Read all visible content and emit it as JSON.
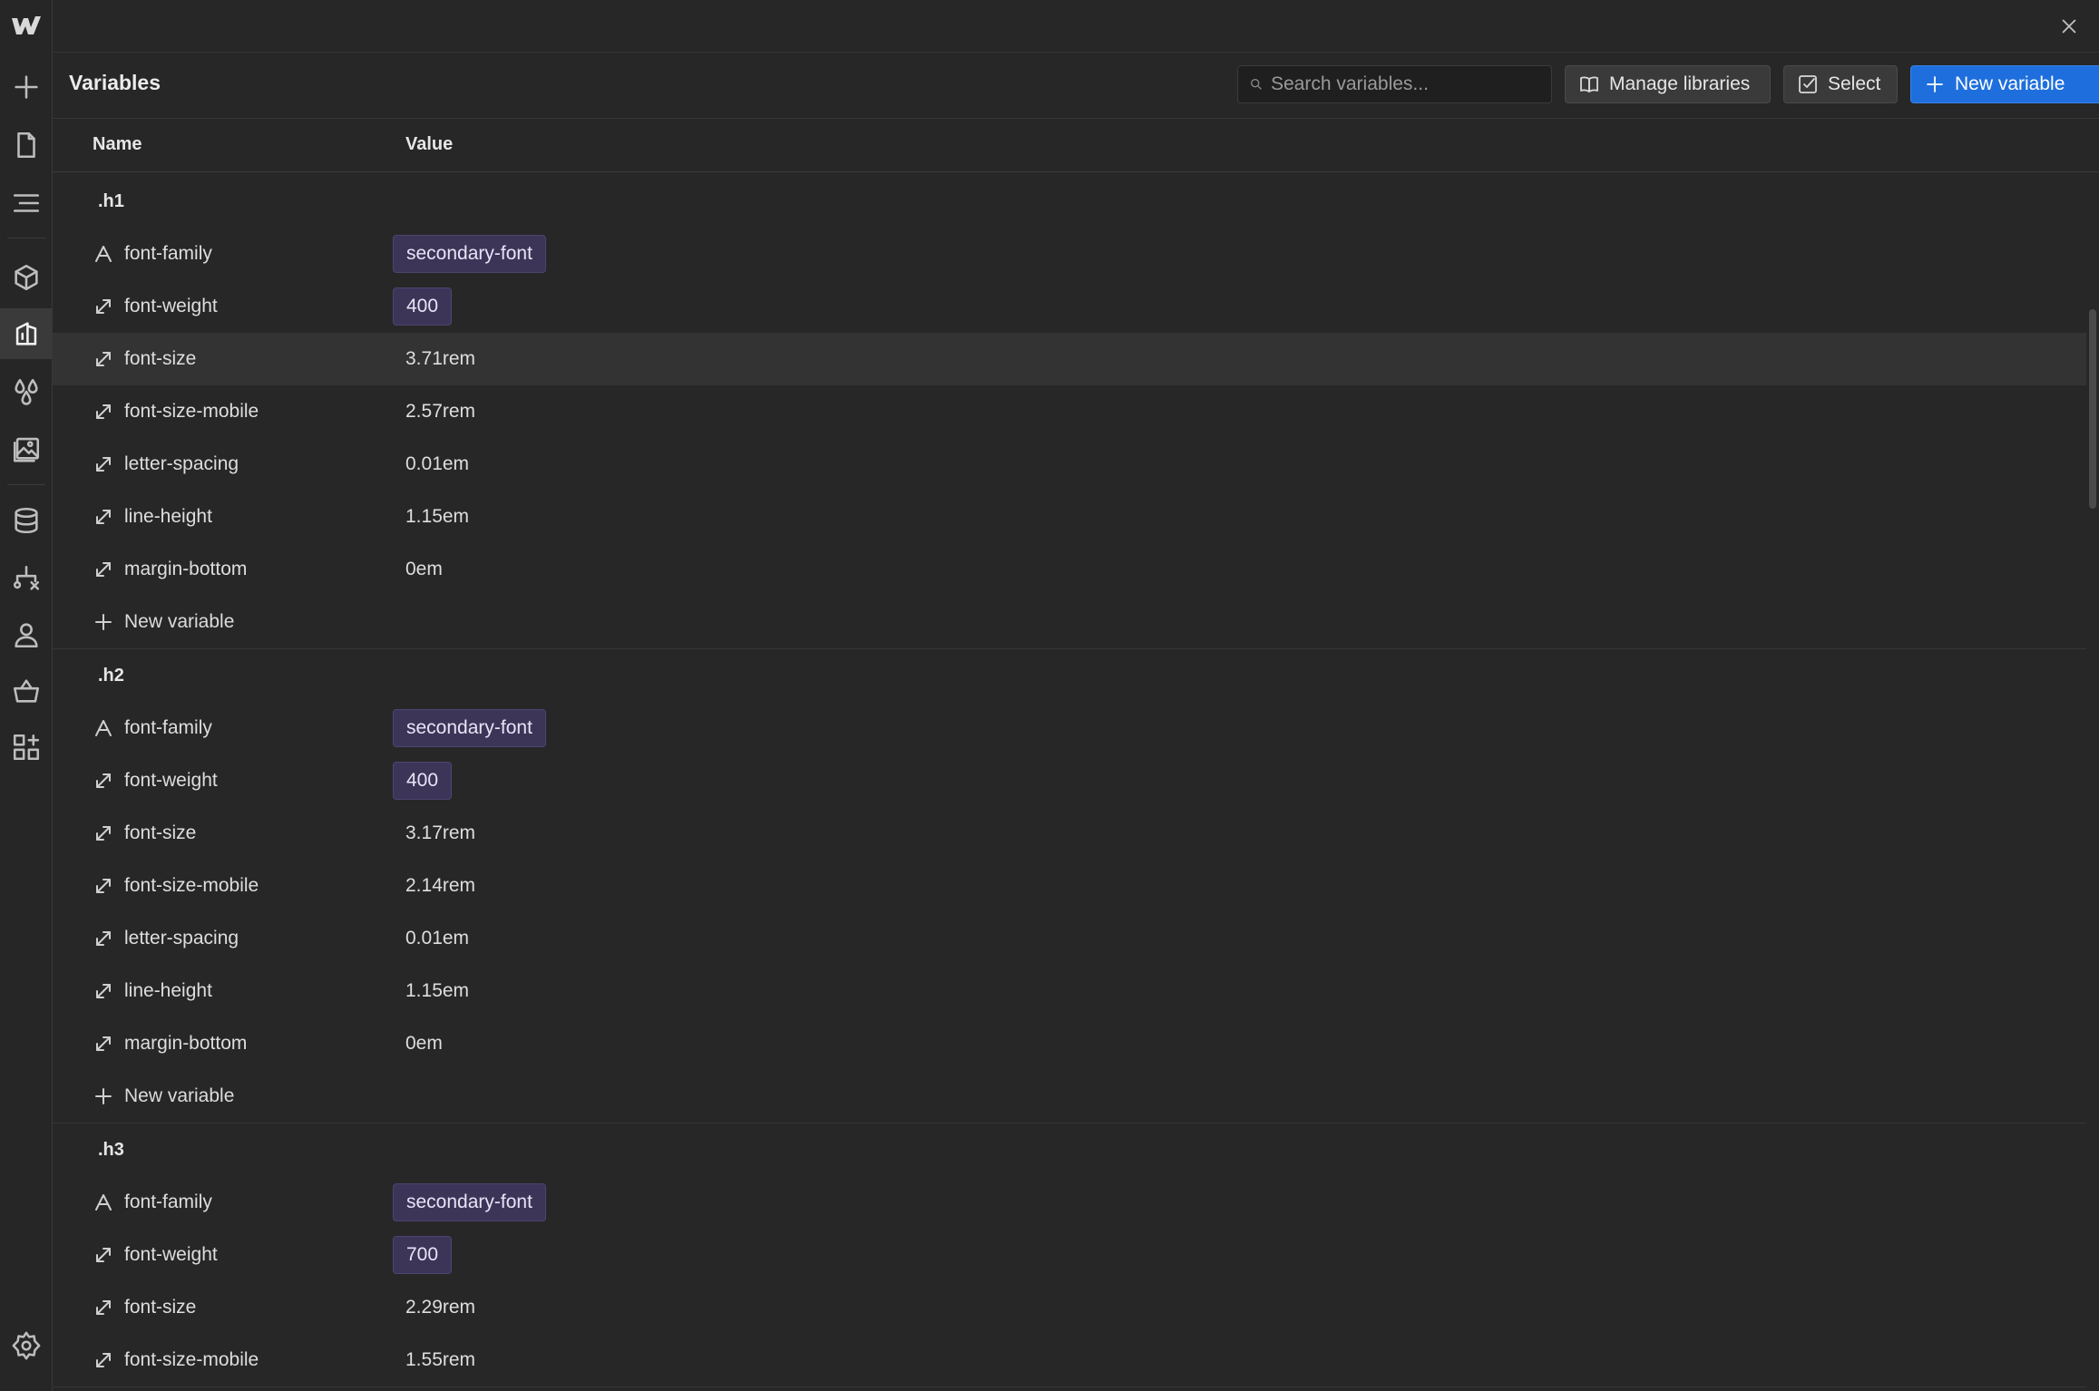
{
  "header": {
    "title": "Variables",
    "search_placeholder": "Search variables...",
    "manage_label": "Manage libraries",
    "select_label": "Select",
    "new_label": "New variable"
  },
  "columns": {
    "name": "Name",
    "value": "Value"
  },
  "groups": [
    {
      "title": ".h1",
      "rows": [
        {
          "name": "font-family",
          "value": "secondary-font",
          "chip": true,
          "icon": "font-family-icon"
        },
        {
          "name": "font-weight",
          "value": "400",
          "chip": true,
          "icon": "size-icon"
        },
        {
          "name": "font-size",
          "value": "3.71rem",
          "chip": false,
          "icon": "size-icon",
          "hover": true
        },
        {
          "name": "font-size-mobile",
          "value": "2.57rem",
          "chip": false,
          "icon": "size-icon"
        },
        {
          "name": "letter-spacing",
          "value": "0.01em",
          "chip": false,
          "icon": "size-icon"
        },
        {
          "name": "line-height",
          "value": "1.15em",
          "chip": false,
          "icon": "size-icon"
        },
        {
          "name": "margin-bottom",
          "value": "0em",
          "chip": false,
          "icon": "size-icon"
        }
      ],
      "add_label": "New variable"
    },
    {
      "title": ".h2",
      "rows": [
        {
          "name": "font-family",
          "value": "secondary-font",
          "chip": true,
          "icon": "font-family-icon"
        },
        {
          "name": "font-weight",
          "value": "400",
          "chip": true,
          "icon": "size-icon"
        },
        {
          "name": "font-size",
          "value": "3.17rem",
          "chip": false,
          "icon": "size-icon"
        },
        {
          "name": "font-size-mobile",
          "value": "2.14rem",
          "chip": false,
          "icon": "size-icon"
        },
        {
          "name": "letter-spacing",
          "value": "0.01em",
          "chip": false,
          "icon": "size-icon"
        },
        {
          "name": "line-height",
          "value": "1.15em",
          "chip": false,
          "icon": "size-icon"
        },
        {
          "name": "margin-bottom",
          "value": "0em",
          "chip": false,
          "icon": "size-icon"
        }
      ],
      "add_label": "New variable"
    },
    {
      "title": ".h3",
      "rows": [
        {
          "name": "font-family",
          "value": "secondary-font",
          "chip": true,
          "icon": "font-family-icon"
        },
        {
          "name": "font-weight",
          "value": "700",
          "chip": true,
          "icon": "size-icon"
        },
        {
          "name": "font-size",
          "value": "2.29rem",
          "chip": false,
          "icon": "size-icon"
        },
        {
          "name": "font-size-mobile",
          "value": "1.55rem",
          "chip": false,
          "icon": "size-icon"
        }
      ]
    }
  ],
  "sidebar": {
    "icons": [
      "logo-icon",
      "add-icon",
      "pages-icon",
      "navigator-icon",
      "components-icon",
      "variables-icon",
      "styles-icon",
      "assets-icon",
      "cms-icon",
      "logic-icon",
      "users-icon",
      "ecommerce-icon",
      "apps-icon",
      "settings-icon"
    ],
    "active": "variables-icon"
  },
  "colors": {
    "background": "#272727",
    "accent": "#1e6fdd",
    "chip": "#3d3558"
  }
}
